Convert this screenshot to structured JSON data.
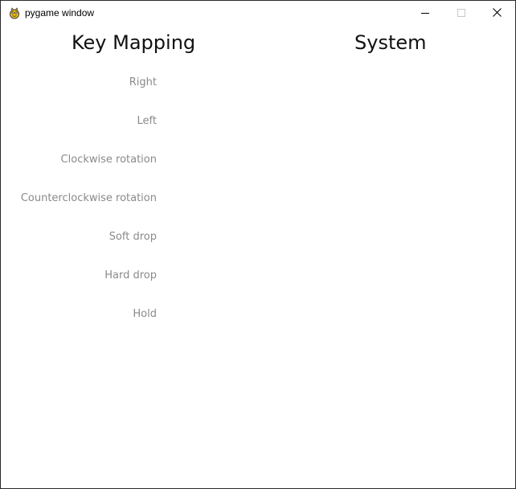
{
  "window": {
    "title": "pygame window",
    "icon": "pygame-snake-icon",
    "controls": {
      "minimize_icon": "minimize-icon",
      "maximize_icon": "maximize-icon",
      "close_icon": "close-icon"
    }
  },
  "main": {
    "key_mapping_heading": "Key Mapping",
    "system_heading": "System",
    "mappings": [
      {
        "label": "Right"
      },
      {
        "label": "Left"
      },
      {
        "label": "Clockwise rotation"
      },
      {
        "label": "Counterclockwise rotation"
      },
      {
        "label": "Soft drop"
      },
      {
        "label": "Hard drop"
      },
      {
        "label": "Hold"
      }
    ]
  },
  "colors": {
    "background": "#ffffff",
    "heading": "#111111",
    "label": "#8a8a8a",
    "border": "#2b2b2b"
  }
}
